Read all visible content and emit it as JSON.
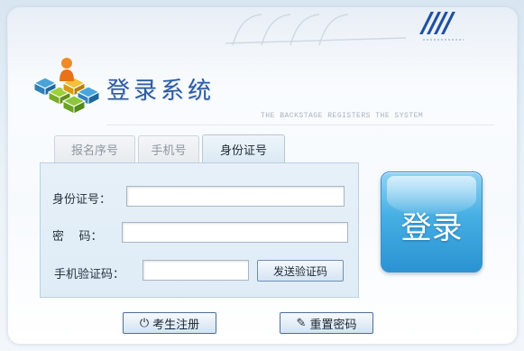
{
  "header": {
    "title": "登录系统",
    "subtitle": "THE BACKSTAGE REGISTERS THE SYSTEM",
    "logo_icon": "cubes-person-logo",
    "decoration_text": "////"
  },
  "tabs": [
    {
      "label": "报名序号",
      "active": false
    },
    {
      "label": "手机号",
      "active": false
    },
    {
      "label": "身份证号",
      "active": true
    }
  ],
  "form": {
    "id_label": "身份证号：",
    "id_value": "",
    "password_label": "密    码：",
    "password_value": "",
    "sms_label": "手机验证码：",
    "sms_value": "",
    "send_code_label": "发送验证码"
  },
  "login_button": {
    "label": "登录"
  },
  "footer": {
    "register_label": "考生注册",
    "register_icon": "power-icon",
    "reset_label": "重置密码",
    "reset_icon": "edit-icon"
  },
  "colors": {
    "title": "#2c5aa3",
    "login_button": "#45aee3",
    "form_background": "#e6f0f8"
  }
}
